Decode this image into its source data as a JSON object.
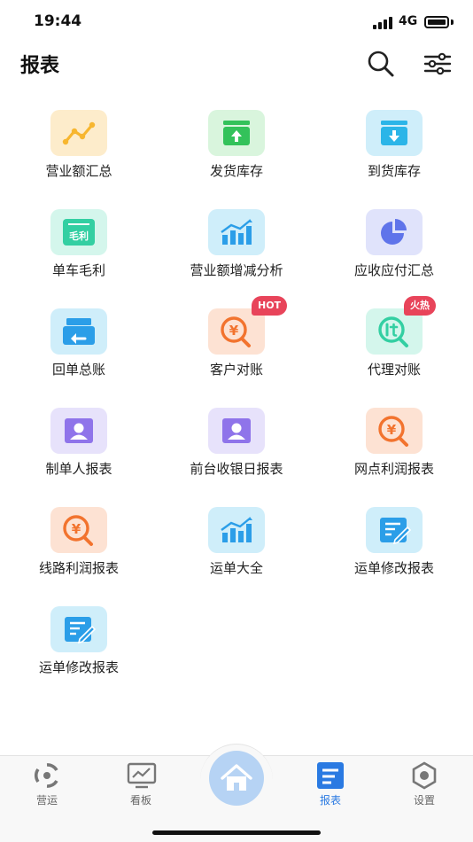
{
  "status_bar": {
    "time": "19:44",
    "network": "4G"
  },
  "header": {
    "title": "报表"
  },
  "reports": [
    {
      "label": "营业额汇总",
      "icon": "trend-line-icon",
      "color": "#f7b62f"
    },
    {
      "label": "发货库存",
      "icon": "box-upload-icon",
      "color": "#33c25a"
    },
    {
      "label": "到货库存",
      "icon": "box-download-icon",
      "color": "#2bb5e8"
    },
    {
      "label": "单车毛利",
      "icon": "gross-profit-icon",
      "icon_text": "毛利",
      "color": "#33cfa2"
    },
    {
      "label": "营业额增减分析",
      "icon": "bar-trend-icon",
      "color": "#2b9ee8"
    },
    {
      "label": "应收应付汇总",
      "icon": "pie-chart-icon",
      "color": "#5f74ea"
    },
    {
      "label": "回单总账",
      "icon": "return-receipt-icon",
      "color": "#2b9ee8"
    },
    {
      "label": "客户对账",
      "icon": "yuan-search-icon",
      "color": "#f2732e",
      "badge": "HOT"
    },
    {
      "label": "代理对账",
      "icon": "agent-search-icon",
      "color": "#33cfa2",
      "badge": "火热"
    },
    {
      "label": "制单人报表",
      "icon": "person-card-icon",
      "color": "#8f74ea"
    },
    {
      "label": "前台收银日报表",
      "icon": "person-card-icon",
      "color": "#8f74ea"
    },
    {
      "label": "网点利润报表",
      "icon": "yuan-search-icon",
      "color": "#f2732e"
    },
    {
      "label": "线路利润报表",
      "icon": "yuan-search-icon",
      "color": "#f2732e"
    },
    {
      "label": "运单大全",
      "icon": "bar-trend-icon",
      "color": "#2b9ee8"
    },
    {
      "label": "运单修改报表",
      "icon": "edit-doc-icon",
      "color": "#2b9ee8"
    },
    {
      "label": "运单修改报表",
      "icon": "edit-doc-icon",
      "color": "#2b9ee8"
    }
  ],
  "tabbar": {
    "items": [
      {
        "label": "营运",
        "icon": "operations-icon"
      },
      {
        "label": "看板",
        "icon": "dashboard-icon"
      },
      {
        "label": "报表",
        "icon": "report-icon",
        "active": true
      },
      {
        "label": "设置",
        "icon": "settings-icon"
      }
    ],
    "home_icon": "home-icon"
  },
  "colors": {
    "accent": "#2a7ae2",
    "home": "#b6d3f4",
    "badge": "#e8445a"
  }
}
